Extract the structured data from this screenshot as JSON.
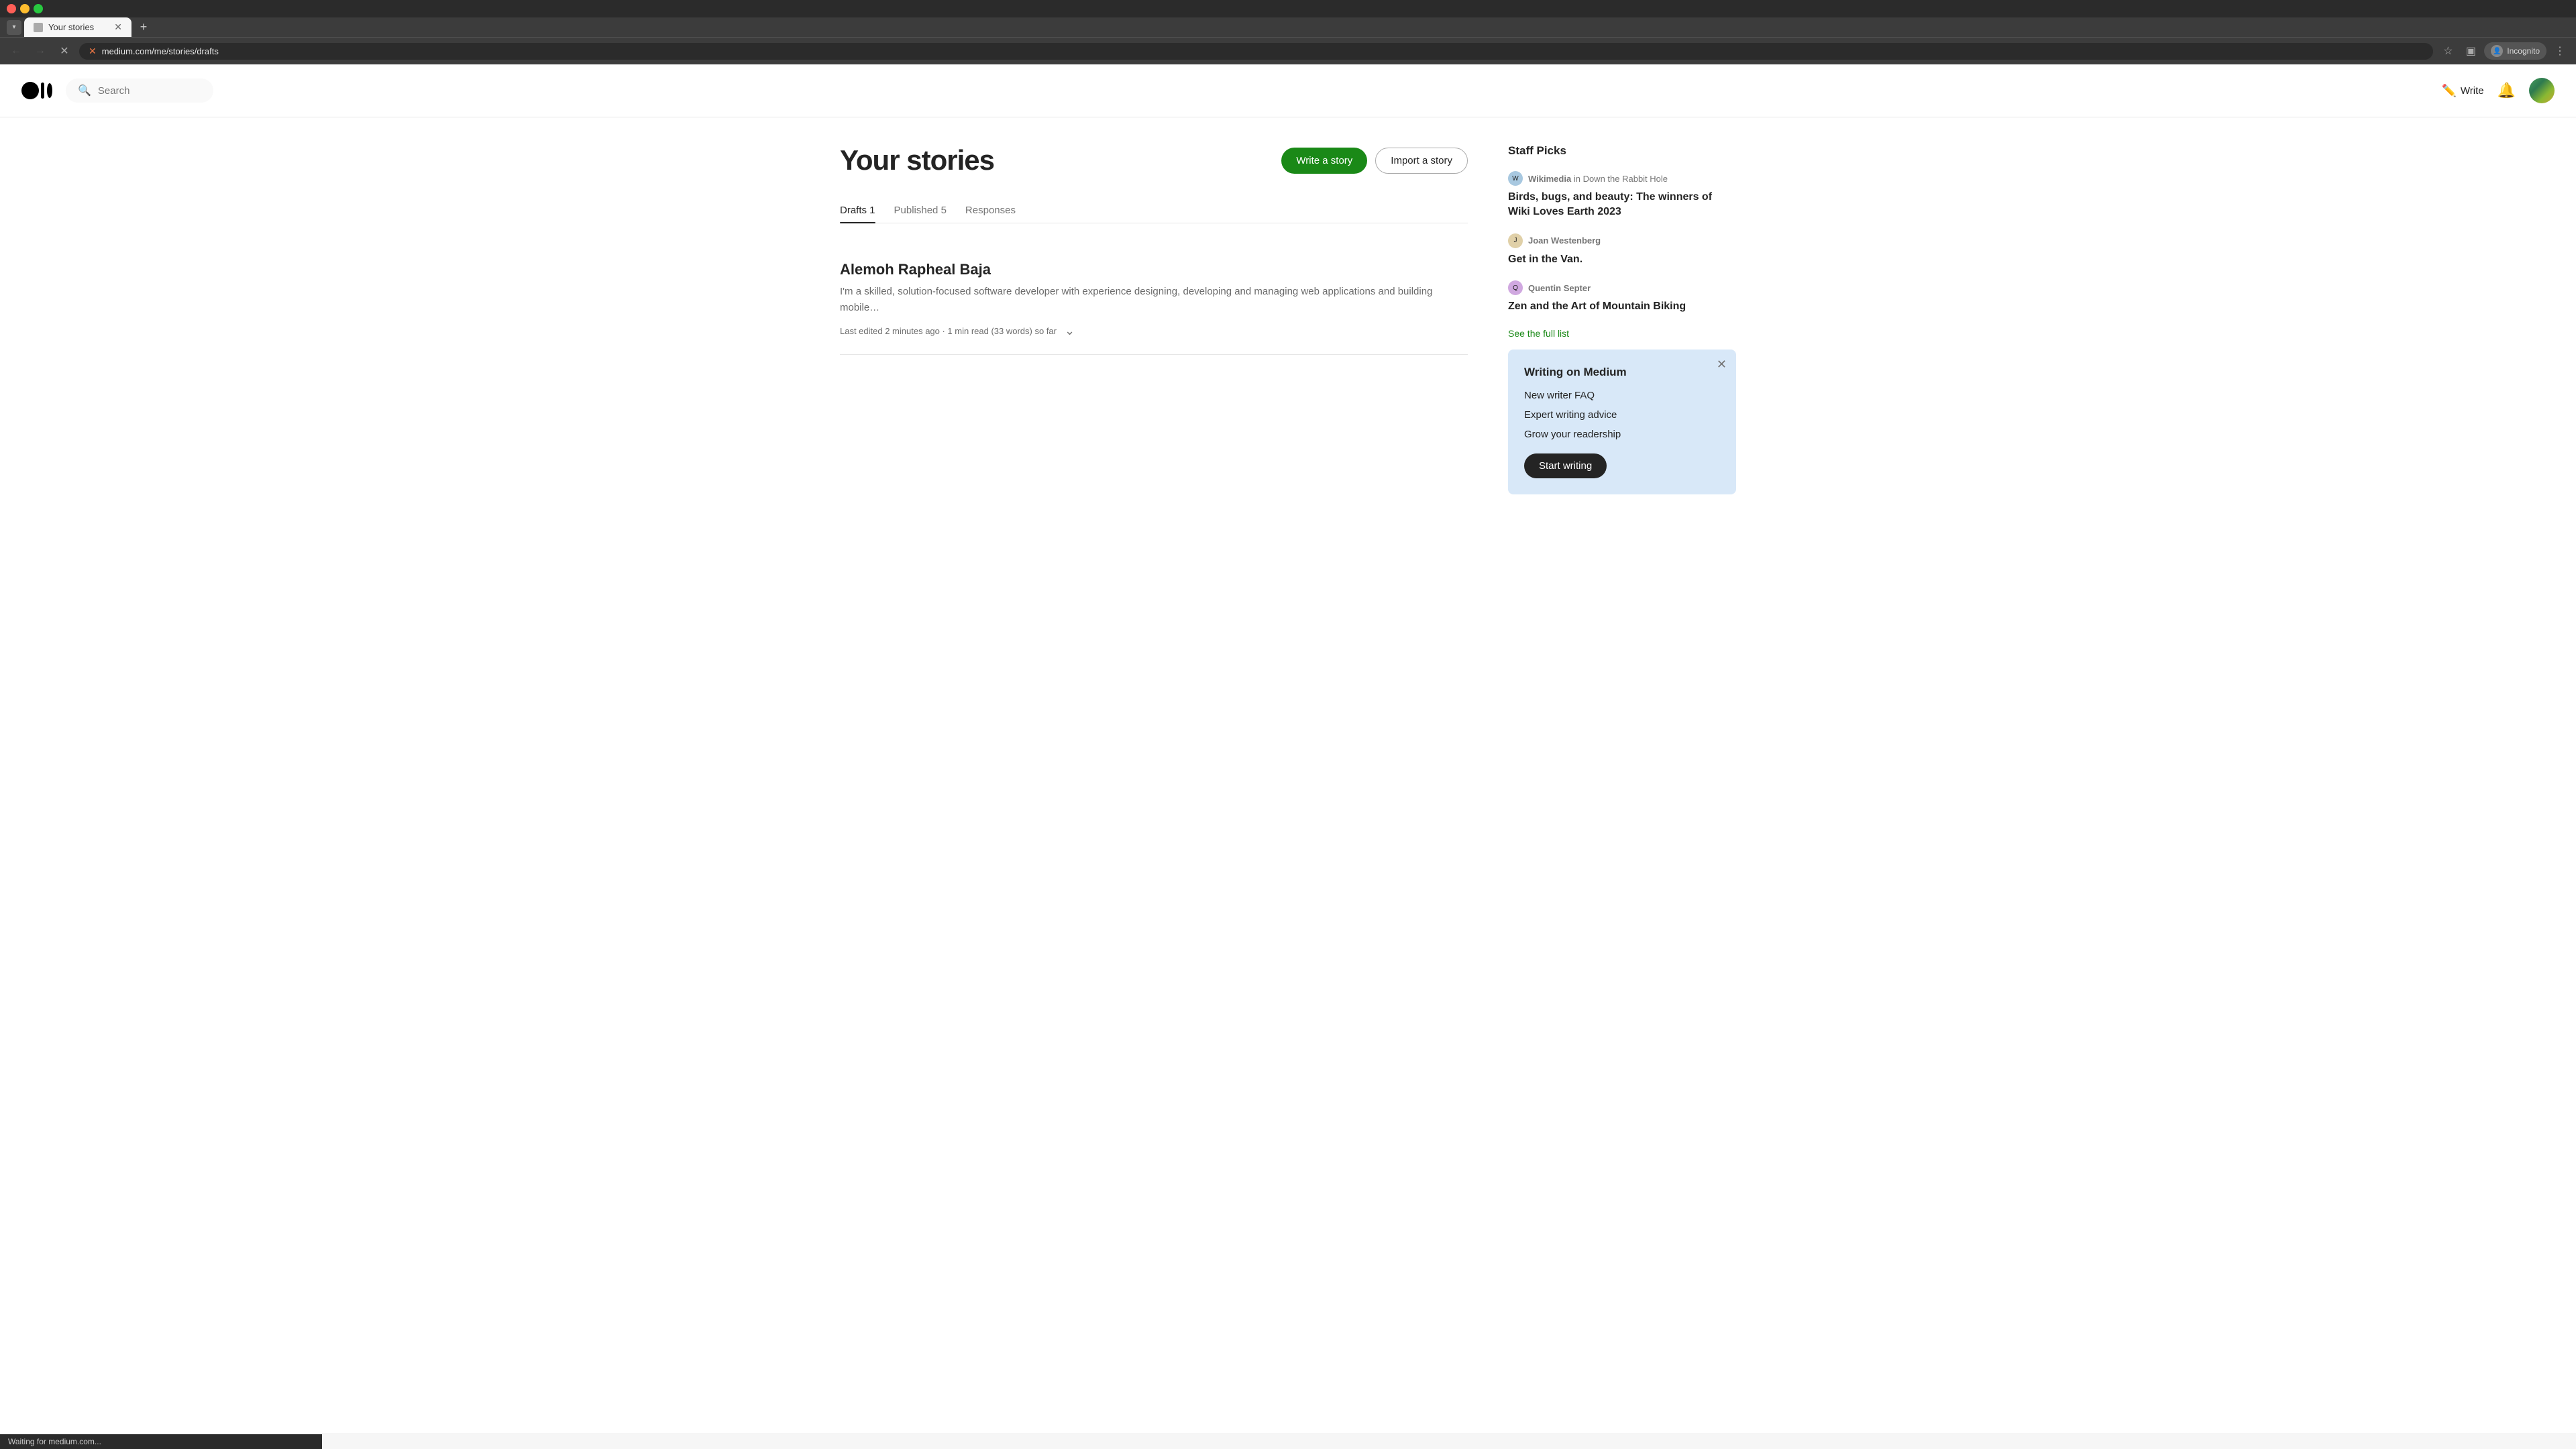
{
  "browser": {
    "tab_title": "Your stories",
    "url": "medium.com/me/stories/drafts",
    "new_tab_symbol": "+",
    "close_symbol": "✕",
    "back_symbol": "←",
    "forward_symbol": "→",
    "reload_symbol": "✕",
    "loading": true,
    "extensions_label": "Incognito",
    "menu_symbol": "⋮"
  },
  "header": {
    "search_placeholder": "Search",
    "write_label": "Write",
    "logo_alt": "Medium"
  },
  "page": {
    "title": "Your stories",
    "write_story_btn": "Write a story",
    "import_story_btn": "Import a story"
  },
  "tabs": [
    {
      "label": "Drafts 1",
      "active": true
    },
    {
      "label": "Published 5",
      "active": false
    },
    {
      "label": "Responses",
      "active": false
    }
  ],
  "stories": [
    {
      "title": "Alemoh Rapheal Baja",
      "excerpt": "I'm a skilled, solution-focused software developer with experience designing, developing and managing web applications and building mobile…",
      "meta": "Last edited 2 minutes ago · 1 min read (33 words) so far"
    }
  ],
  "sidebar": {
    "staff_picks_title": "Staff Picks",
    "see_full_list": "See the full list",
    "picks": [
      {
        "author": "Wikimedia",
        "publication": "Down the Rabbit Hole",
        "title": "Birds, bugs, and beauty: The winners of Wiki Loves Earth 2023",
        "avatar_type": "wiki"
      },
      {
        "author": "Joan Westenberg",
        "publication": "",
        "title": "Get in the Van.",
        "avatar_type": "joan"
      },
      {
        "author": "Quentin Septer",
        "publication": "",
        "title": "Zen and the Art of Mountain Biking",
        "avatar_type": "quentin"
      }
    ],
    "writing_card": {
      "title": "Writing on Medium",
      "links": [
        "New writer FAQ",
        "Expert writing advice",
        "Grow your readership"
      ],
      "start_btn": "Start writing",
      "close_symbol": "✕"
    }
  },
  "status_bar": {
    "text": "Waiting for medium.com..."
  }
}
